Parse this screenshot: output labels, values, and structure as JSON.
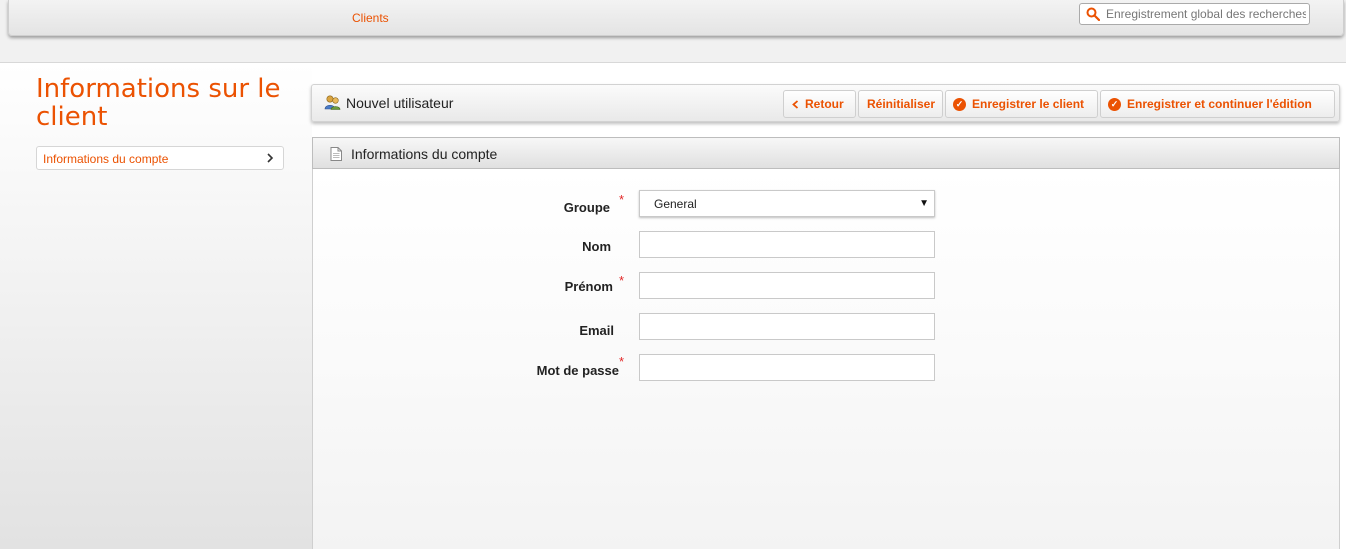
{
  "nav": {
    "clients_label": "Clients",
    "search_placeholder": "Enregistrement global des recherches"
  },
  "sidebar": {
    "title": "Informations sur le client",
    "items": [
      {
        "label": "Informations du compte"
      }
    ]
  },
  "action_bar": {
    "title": "Nouvel utilisateur",
    "buttons": {
      "back": "Retour",
      "reset": "Réinitialiser",
      "save": "Enregistrer le client",
      "save_continue": "Enregistrer et continuer l'édition"
    }
  },
  "section": {
    "title": "Informations du compte"
  },
  "form": {
    "required_mark": "*",
    "fields": {
      "group": {
        "label": "Groupe",
        "value": "General",
        "required": true
      },
      "lastname": {
        "label": "Nom",
        "value": "",
        "required": false
      },
      "firstname": {
        "label": "Prénom",
        "value": "",
        "required": true
      },
      "email": {
        "label": "Email",
        "value": "",
        "required": false
      },
      "password": {
        "label": "Mot de passe",
        "value": "",
        "required": true
      }
    }
  },
  "colors": {
    "accent": "#eb5202",
    "required": "#e22626"
  }
}
